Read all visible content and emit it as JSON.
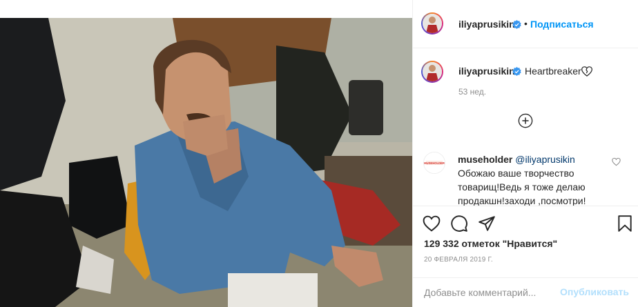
{
  "post": {
    "author": "iliyaprusikin",
    "follow_label": "Подписаться",
    "separator": "•",
    "caption": "Heartbreaker",
    "time_ago": "53 нед.",
    "likes": "129 332 отметок \"Нравится\"",
    "date": "20 ФЕВРАЛЯ 2019 Г."
  },
  "comment": {
    "user": "museholder",
    "mention": "@iliyaprusikin",
    "text": "Обожаю ваше творчество товарищ!Ведь я тоже делаю продакшн!заходи ,посмотри!",
    "avatar_label": "MUSEHOLDER"
  },
  "compose": {
    "placeholder": "Добавьте комментарий...",
    "publish_label": "Опубликовать"
  },
  "icons": {
    "verified": "verified-badge-icon",
    "like": "heart-icon",
    "comment": "speech-bubble-icon",
    "share": "paper-plane-icon",
    "save": "bookmark-icon",
    "load_more": "plus-circle-icon"
  },
  "colors": {
    "link": "#0095f6",
    "verified": "#3897f0",
    "publish_disabled": "#b2dffc",
    "muted": "#8e8e8e"
  }
}
